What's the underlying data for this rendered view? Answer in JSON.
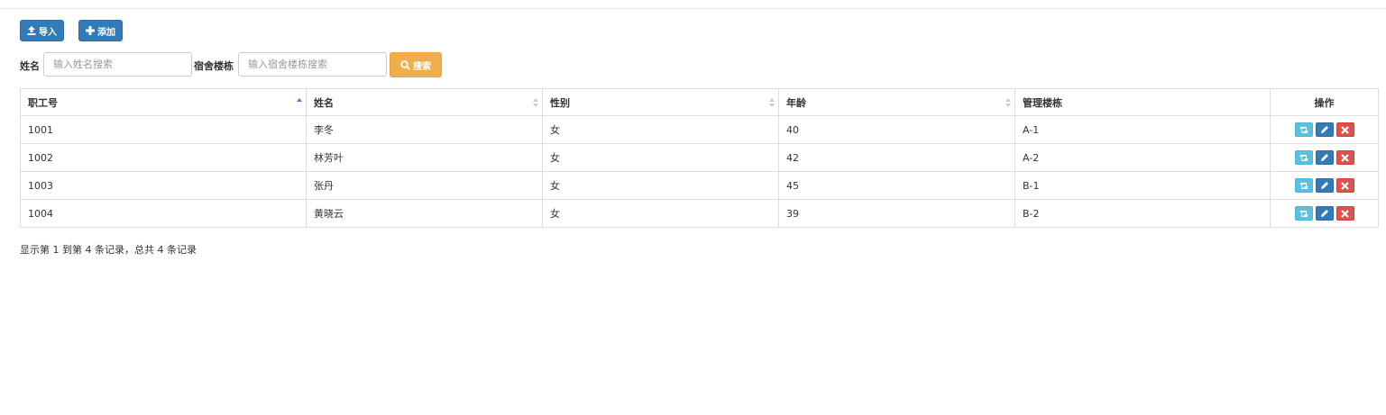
{
  "toolbar": {
    "import_label": "导入",
    "add_label": "添加"
  },
  "search": {
    "name_label": "姓名",
    "name_placeholder": "输入姓名搜索",
    "building_label": "宿舍楼栋",
    "building_placeholder": "输入宿舍楼栋搜索",
    "search_label": "搜索"
  },
  "table": {
    "columns": [
      "职工号",
      "姓名",
      "性别",
      "年龄",
      "管理楼栋",
      "操作"
    ],
    "rows": [
      [
        "1001",
        "李冬",
        "女",
        "40",
        "A-1"
      ],
      [
        "1002",
        "林芳叶",
        "女",
        "42",
        "A-2"
      ],
      [
        "1003",
        "张丹",
        "女",
        "45",
        "B-1"
      ],
      [
        "1004",
        "黄晓云",
        "女",
        "39",
        "B-2"
      ]
    ]
  },
  "pagination": {
    "summary": "显示第 1 到第 4 条记录，总共 4 条记录"
  },
  "icons": [
    "upload-icon",
    "plus-icon",
    "search-icon",
    "sort-asc-icon",
    "sort-both-icon",
    "retweet-icon",
    "pencil-icon",
    "remove-icon"
  ],
  "colors": {
    "primary": "#337ab7",
    "warning": "#f0ad4e",
    "info": "#5bc0de",
    "danger": "#d9534f",
    "sort_active": "#4a7cc7"
  }
}
